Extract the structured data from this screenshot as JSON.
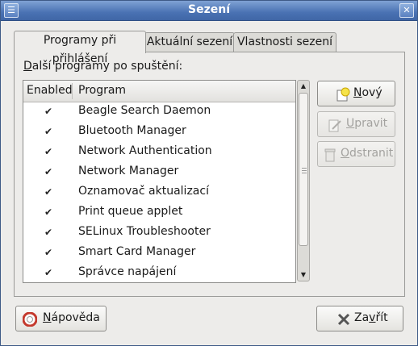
{
  "window": {
    "title": "Sezení"
  },
  "tabs": [
    {
      "label": "Programy při přihlášení",
      "active": true
    },
    {
      "label": "Aktuální sezení",
      "active": false
    },
    {
      "label": "Vlastnosti sezení",
      "active": false
    }
  ],
  "startup": {
    "section_label_mnemonic": "D",
    "section_label_rest": "alší programy po spuštění:",
    "columns": {
      "enabled": "Enabled",
      "program": "Program"
    },
    "programs": [
      {
        "name": "Beagle Search Daemon",
        "enabled": true
      },
      {
        "name": "Bluetooth Manager",
        "enabled": true
      },
      {
        "name": "Network Authentication",
        "enabled": true
      },
      {
        "name": "Network Manager",
        "enabled": true
      },
      {
        "name": "Oznamovač aktualizací",
        "enabled": true
      },
      {
        "name": "Print queue applet",
        "enabled": true
      },
      {
        "name": "SELinux Troubleshooter",
        "enabled": true
      },
      {
        "name": "Smart Card Manager",
        "enabled": true
      },
      {
        "name": "Správce napájení",
        "enabled": true
      }
    ]
  },
  "buttons": {
    "new": {
      "mn": "N",
      "rest": "ový"
    },
    "edit": {
      "mn": "U",
      "rest": "pravit",
      "disabled": true
    },
    "remove": {
      "mn": "O",
      "rest": "dstranit",
      "disabled": true
    },
    "help": {
      "mn": "N",
      "rest": "ápověda"
    },
    "close": {
      "pre": "Za",
      "mn": "v",
      "post": "řít"
    }
  },
  "icons": {
    "window_menu": "window-menu-icon",
    "close": "close-icon",
    "new": "new-icon",
    "edit": "edit-icon",
    "remove": "trash-icon",
    "help": "lifebuoy-icon",
    "cancel": "x-icon"
  }
}
